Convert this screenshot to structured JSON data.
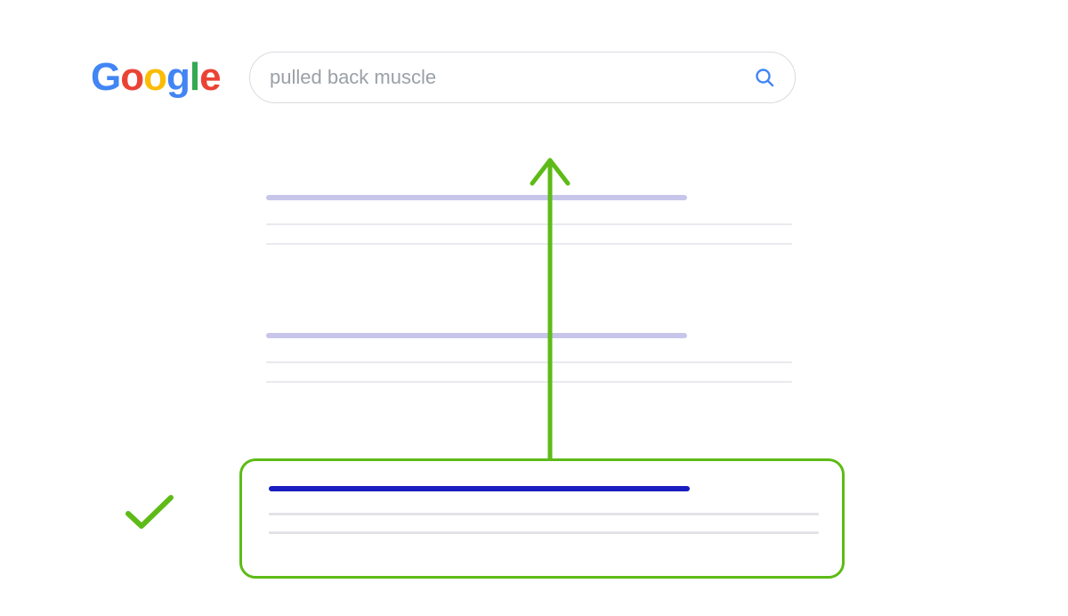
{
  "logo": {
    "letters": [
      "G",
      "o",
      "o",
      "g",
      "l",
      "e"
    ],
    "colors": [
      "#4285F4",
      "#EA4335",
      "#FBBC05",
      "#4285F4",
      "#34A853",
      "#EA4335"
    ]
  },
  "search": {
    "query": "pulled back muscle",
    "placeholder": "Search"
  },
  "results": {
    "placeholder_count": 2,
    "highlighted_index": 2,
    "title_color_default": "#c7c6ea",
    "title_color_highlight": "#1a1dbf",
    "snippet_color": "#e9e9ef"
  },
  "annotation": {
    "arrow_color": "#5EBB17",
    "highlight_border_color": "#5EBB17",
    "checkmark_color": "#5EBB17",
    "meaning": "highlighted result should rank higher"
  }
}
